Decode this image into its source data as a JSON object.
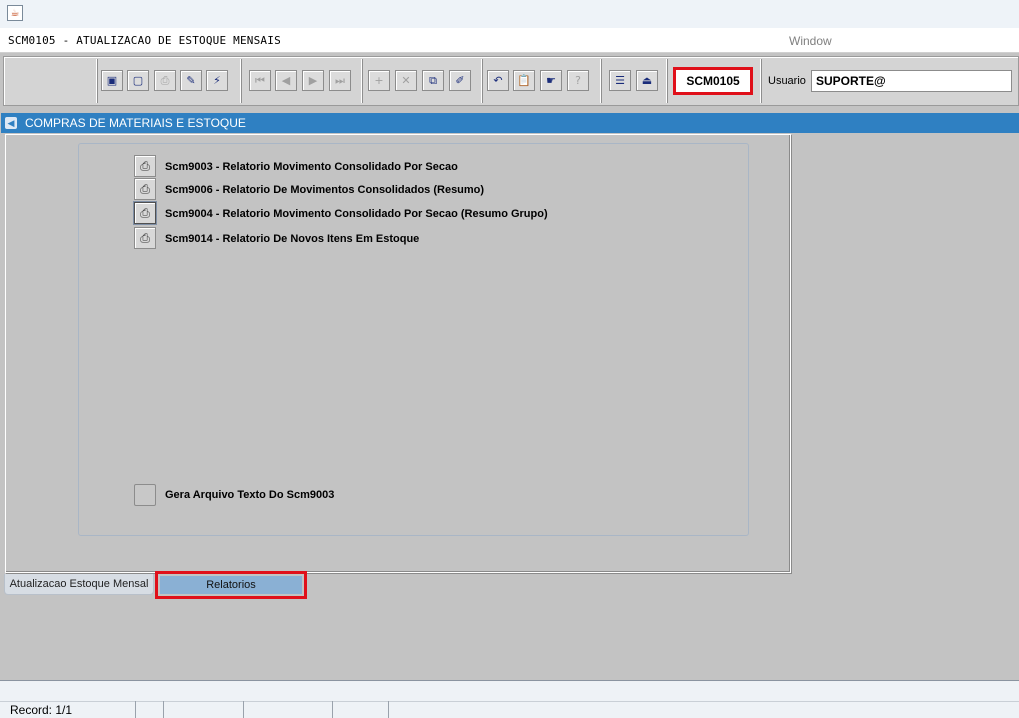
{
  "window": {
    "title_icon": "java-coffee-icon",
    "form_title": "SCM0105 - ATUALIZACAO DE ESTOQUE MENSAIS",
    "menu_window": "Window"
  },
  "toolbar": {
    "buttons": [
      {
        "name": "save-icon",
        "glyph": "▣",
        "enabled": true
      },
      {
        "name": "print-screen-icon",
        "glyph": "▢",
        "enabled": true
      },
      {
        "name": "printer-icon",
        "glyph": "⎙",
        "enabled": false
      },
      {
        "name": "enter-query-icon",
        "glyph": "✎",
        "enabled": true
      },
      {
        "name": "execute-query-icon",
        "glyph": "⚡",
        "enabled": true
      },
      {
        "name": "first-record-icon",
        "glyph": "⏮",
        "enabled": false
      },
      {
        "name": "previous-record-icon",
        "glyph": "◀",
        "enabled": false
      },
      {
        "name": "next-record-icon",
        "glyph": "▶",
        "enabled": false
      },
      {
        "name": "last-record-icon",
        "glyph": "⏭",
        "enabled": false
      },
      {
        "name": "insert-record-icon",
        "glyph": "+",
        "enabled": false
      },
      {
        "name": "delete-record-icon",
        "glyph": "✕",
        "enabled": false
      },
      {
        "name": "duplicate-record-icon",
        "glyph": "⧉",
        "enabled": true
      },
      {
        "name": "clear-record-icon",
        "glyph": "✐",
        "enabled": true
      },
      {
        "name": "undo-icon",
        "glyph": "↶",
        "enabled": true
      },
      {
        "name": "clipboard-icon",
        "glyph": "📋",
        "enabled": false
      },
      {
        "name": "hand-icon",
        "glyph": "☛",
        "enabled": true
      },
      {
        "name": "help-icon",
        "glyph": "?",
        "enabled": false
      },
      {
        "name": "menu-icon",
        "glyph": "☰",
        "enabled": true
      },
      {
        "name": "exit-icon",
        "glyph": "⏏",
        "enabled": true
      }
    ],
    "module_code": "SCM0105",
    "user_label": "Usuario",
    "user_value": "SUPORTE@"
  },
  "header": {
    "icon": "collapse-icon",
    "title": "COMPRAS DE MATERIAIS E ESTOQUE"
  },
  "reports": [
    {
      "label": "Scm9003 - Relatorio Movimento Consolidado Por Secao",
      "icon": "printer-icon"
    },
    {
      "label": "Scm9006 - Relatorio De Movimentos Consolidados (Resumo)",
      "icon": "printer-icon"
    },
    {
      "label": "Scm9004 - Relatorio Movimento Consolidado Por Secao (Resumo Grupo)",
      "icon": "printer-icon"
    },
    {
      "label": "Scm9014 - Relatorio De Novos Itens Em Estoque",
      "icon": "printer-icon"
    }
  ],
  "checkbox": {
    "label": "Gera Arquivo Texto Do Scm9003",
    "checked": false
  },
  "tabs": [
    {
      "label": "Atualizacao Estoque Mensal",
      "active": false
    },
    {
      "label": "Relatorios",
      "active": true
    }
  ],
  "status": {
    "record": "Record: 1/1"
  },
  "colors": {
    "header_bar": "#2f80c2",
    "highlight": "#e0101a",
    "active_tab": "#8ab0d4"
  }
}
